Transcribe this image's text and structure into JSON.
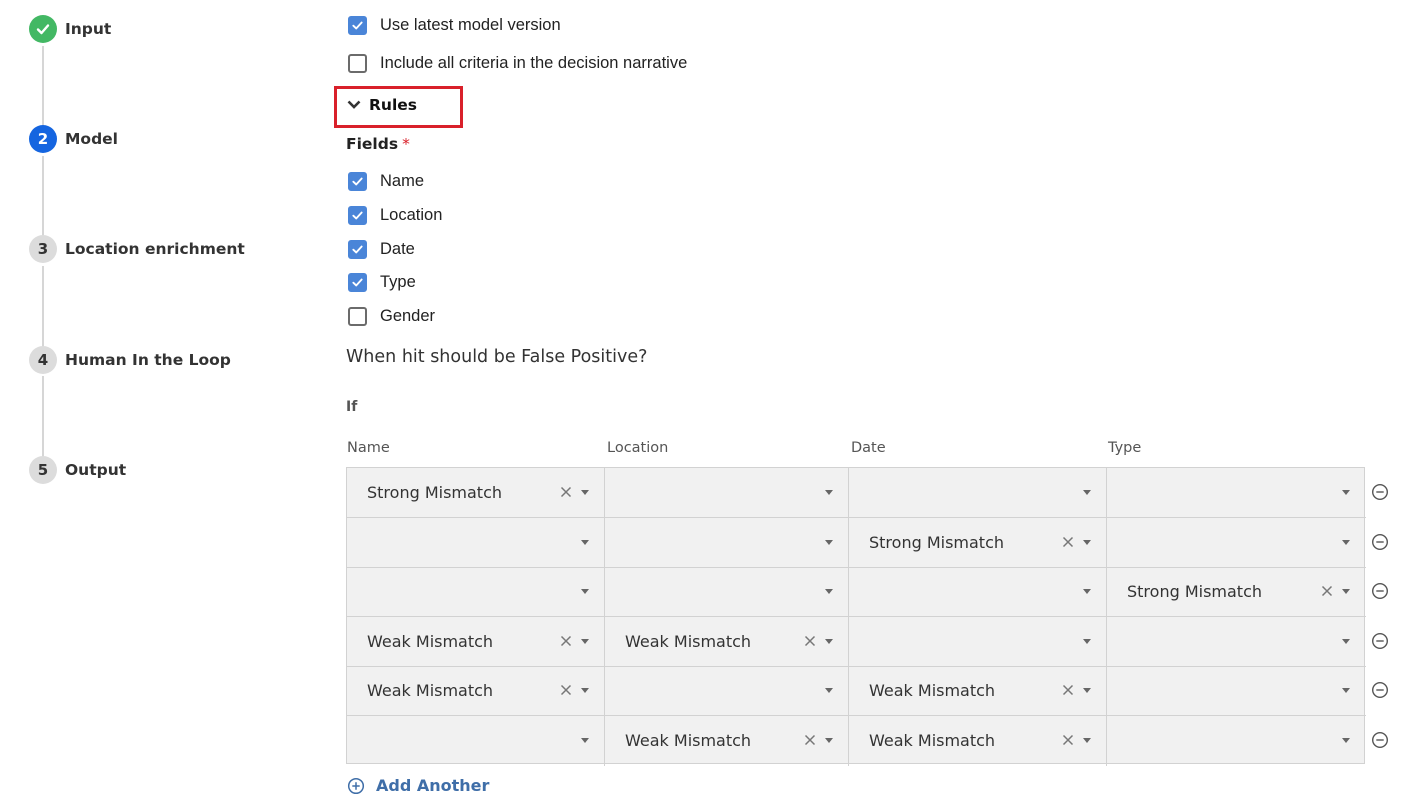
{
  "stepper": {
    "steps": [
      {
        "number": "✓",
        "label": "Input",
        "state": "done"
      },
      {
        "number": "2",
        "label": "Model",
        "state": "active"
      },
      {
        "number": "3",
        "label": "Location enrichment",
        "state": "pending"
      },
      {
        "number": "4",
        "label": "Human In the Loop",
        "state": "pending"
      },
      {
        "number": "5",
        "label": "Output",
        "state": "pending"
      }
    ]
  },
  "options": {
    "use_latest": {
      "label": "Use latest model version",
      "checked": true
    },
    "include_all": {
      "label": "Include all criteria in the decision narrative",
      "checked": false
    }
  },
  "rules": {
    "title": "Rules",
    "fields_label": "Fields",
    "required_mark": "*",
    "fields": [
      {
        "label": "Name",
        "checked": true
      },
      {
        "label": "Location",
        "checked": true
      },
      {
        "label": "Date",
        "checked": true
      },
      {
        "label": "Type",
        "checked": true
      },
      {
        "label": "Gender",
        "checked": false
      }
    ],
    "question": "When hit should be False Positive?",
    "if_label": "If",
    "columns": [
      "Name",
      "Location",
      "Date",
      "Type"
    ],
    "rows": [
      [
        "Strong Mismatch",
        "",
        "",
        ""
      ],
      [
        "",
        "",
        "Strong Mismatch",
        ""
      ],
      [
        "",
        "",
        "",
        "Strong Mismatch"
      ],
      [
        "Weak Mismatch",
        "Weak Mismatch",
        "",
        ""
      ],
      [
        "Weak Mismatch",
        "",
        "Weak Mismatch",
        ""
      ],
      [
        "",
        "Weak Mismatch",
        "Weak Mismatch",
        ""
      ]
    ],
    "add_another": "Add Another"
  },
  "colors": {
    "accent": "#1565e0",
    "done": "#43b864",
    "checkbox": "#4a85d8",
    "highlight": "#d9202a",
    "link": "#3f6ea8"
  }
}
